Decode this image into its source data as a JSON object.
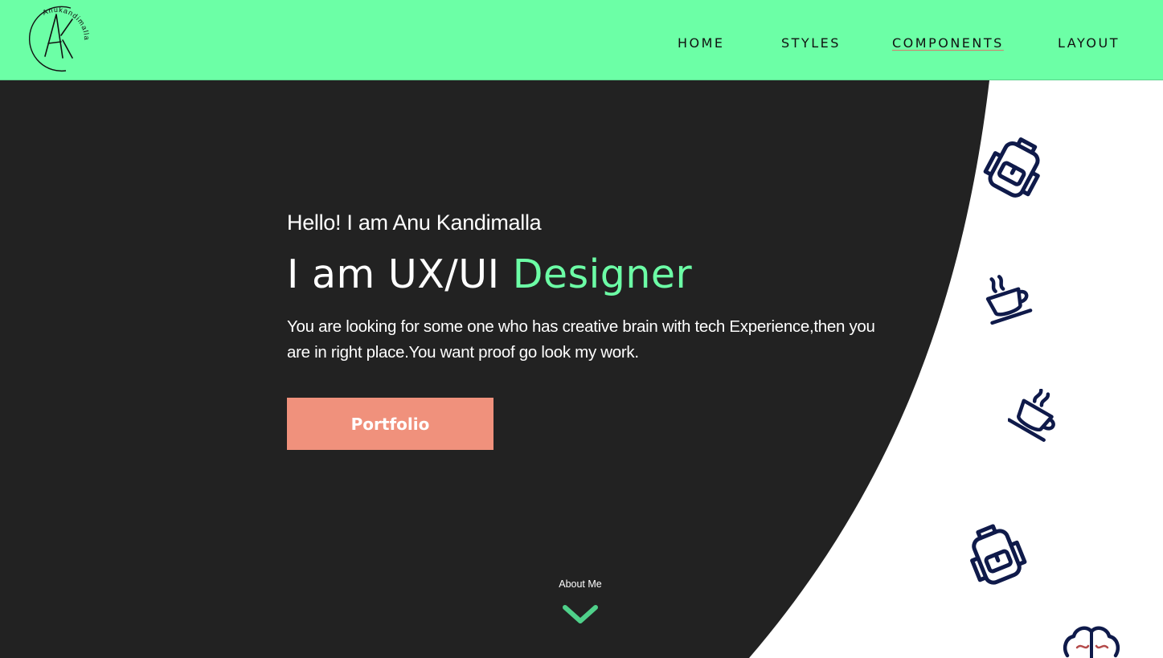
{
  "header": {
    "logo": {
      "monogram": "AK",
      "ring_text": "Anukandimalla",
      "icon": "ak-monogram-logo"
    },
    "nav": [
      {
        "label": "HOME",
        "active": false
      },
      {
        "label": "STYLES",
        "active": false
      },
      {
        "label": "COMPONENTS",
        "active": true
      },
      {
        "label": "LAYOUT",
        "active": false
      }
    ]
  },
  "hero": {
    "greeting": "Hello! I am Anu Kandimalla",
    "title_prefix": "I am UX/UI ",
    "title_accent": "Designer",
    "description": "You are looking for some one who has creative brain with tech Experience,then you are in right place.You want proof go look my work.",
    "cta_label": "Portfolio",
    "scroll_label": "About Me",
    "scroll_icon": "chevron-down-icon"
  },
  "decorations": [
    {
      "icon": "backpack-icon"
    },
    {
      "icon": "coffee-cup-icon"
    },
    {
      "icon": "coffee-cup-icon"
    },
    {
      "icon": "backpack-icon"
    },
    {
      "icon": "brain-icon"
    }
  ],
  "colors": {
    "header_bg": "#6cffa6",
    "hero_bg": "#222222",
    "accent_green": "#6cffa6",
    "button_bg": "#f0917c",
    "icon_navy": "#0f1a4a",
    "chevron_green": "#4fd08a"
  }
}
